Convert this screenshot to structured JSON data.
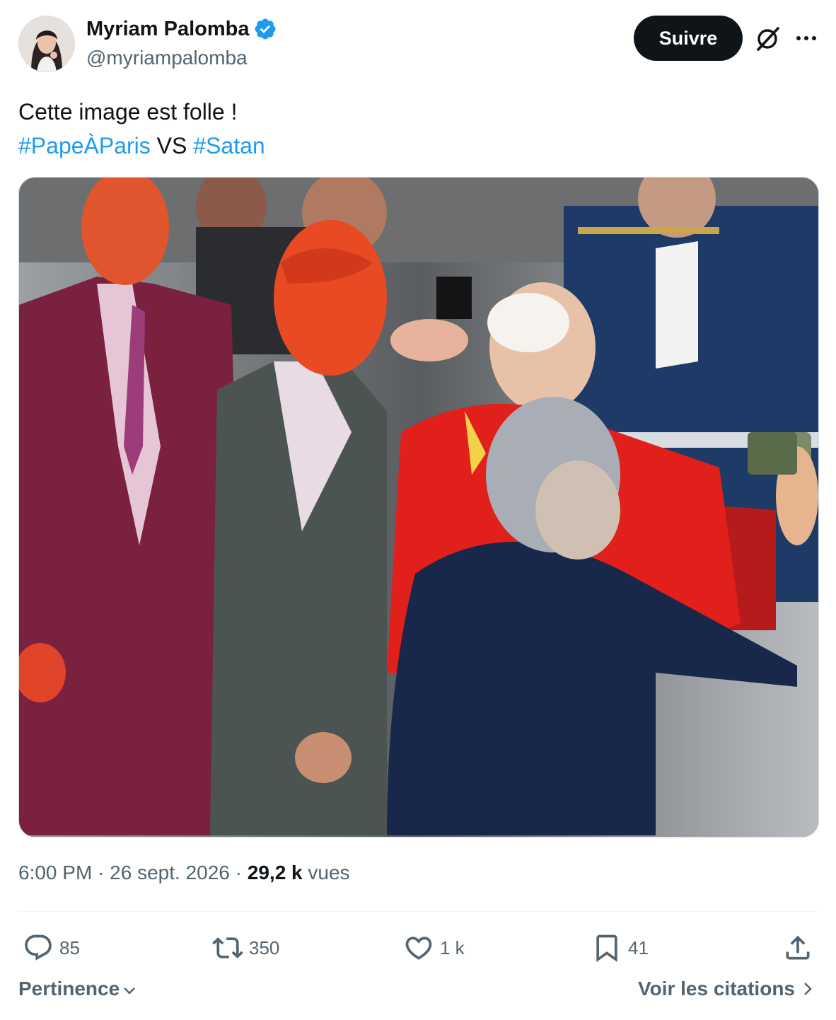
{
  "author": {
    "display_name": "Myriam Palomba",
    "handle": "@myriampalomba",
    "verified": true
  },
  "header": {
    "follow_label": "Suivre",
    "grok_icon": "grok-icon",
    "more_icon": "more-icon"
  },
  "tweet": {
    "line1": "Cette image est folle !",
    "hashtag1": "#PapeÀParis",
    "vs": " VS ",
    "hashtag2": "#Satan"
  },
  "meta": {
    "time": "6:00 PM",
    "sep1": " · ",
    "date": "26 sept. 2026",
    "sep2": " · ",
    "views_count": "29,2 k",
    "views_label": " vues"
  },
  "actions": {
    "replies": "85",
    "reposts": "350",
    "likes": "1 k",
    "bookmarks": "41"
  },
  "footer": {
    "sort_label": "Pertinence",
    "quotes_label": "Voir les citations"
  },
  "colors": {
    "accent": "#1d9bf0",
    "text": "#0f1419",
    "muted": "#536471",
    "button": "#0f1419"
  }
}
